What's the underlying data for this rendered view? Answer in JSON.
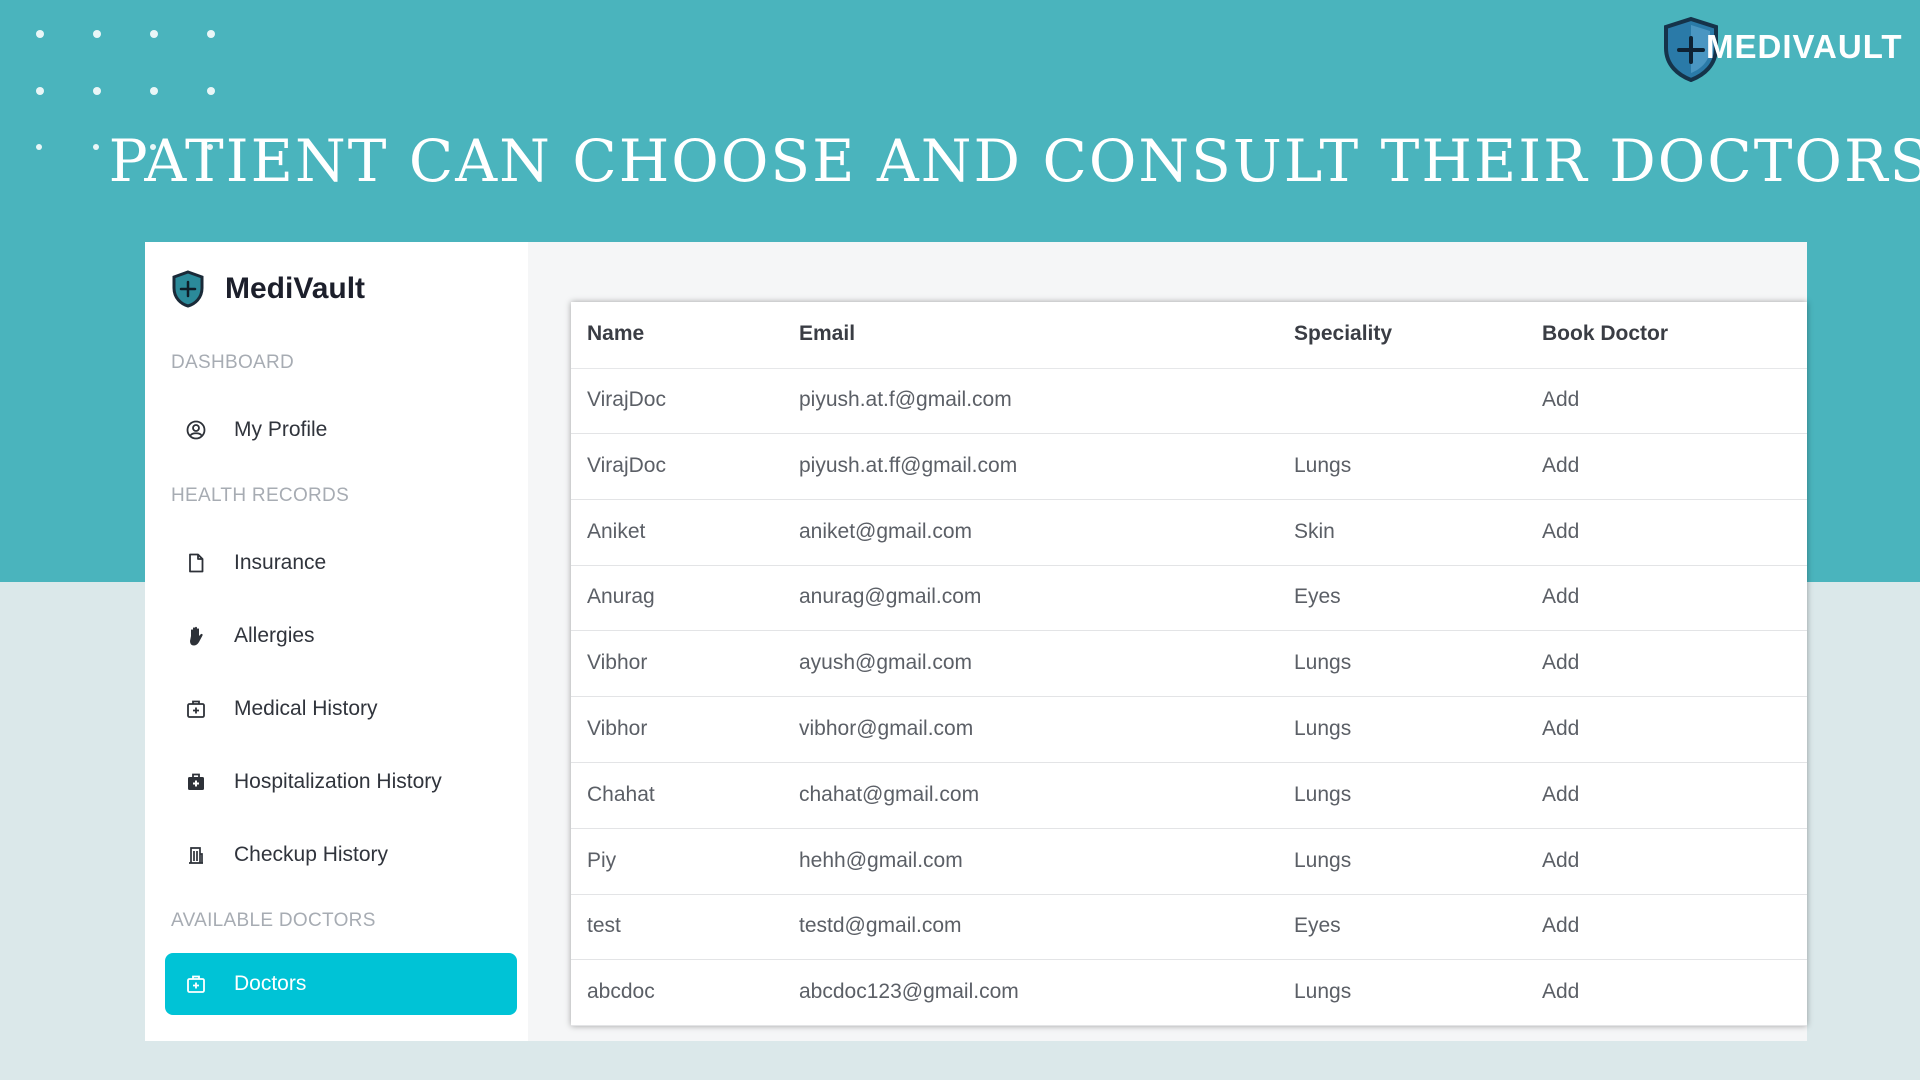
{
  "slide": {
    "title": "PATIENT CAN CHOOSE AND CONSULT THEIR DOCTORS",
    "brand": "MEDIVAULT",
    "colors": {
      "top_band": "#4ab4bd",
      "background": "#dbe8ea",
      "accent": "#00c3d6"
    }
  },
  "app": {
    "name": "MediVault",
    "sections": {
      "dashboard": "DASHBOARD",
      "health_records": "HEALTH RECORDS",
      "available_doctors": "AVAILABLE DOCTORS"
    },
    "nav": {
      "my_profile": {
        "label": "My Profile",
        "icon": "user-circle-icon"
      },
      "insurance": {
        "label": "Insurance",
        "icon": "file-icon"
      },
      "allergies": {
        "label": "Allergies",
        "icon": "hand-icon"
      },
      "medical_history": {
        "label": "Medical History",
        "icon": "medical-bag-icon"
      },
      "hospitalization_history": {
        "label": "Hospitalization History",
        "icon": "medical-kit-icon"
      },
      "checkup_history": {
        "label": "Checkup History",
        "icon": "hospital-icon"
      },
      "doctors": {
        "label": "Doctors",
        "icon": "medical-bag-icon",
        "active": true
      }
    }
  },
  "table": {
    "columns": {
      "name": "Name",
      "email": "Email",
      "speciality": "Speciality",
      "book": "Book Doctor"
    },
    "rows": [
      {
        "name": "VirajDoc",
        "email": "piyush.at.f@gmail.com",
        "speciality": "",
        "book": "Add"
      },
      {
        "name": "VirajDoc",
        "email": "piyush.at.ff@gmail.com",
        "speciality": "Lungs",
        "book": "Add"
      },
      {
        "name": "Aniket",
        "email": "aniket@gmail.com",
        "speciality": "Skin",
        "book": "Add"
      },
      {
        "name": "Anurag",
        "email": "anurag@gmail.com",
        "speciality": "Eyes",
        "book": "Add"
      },
      {
        "name": "Vibhor",
        "email": "ayush@gmail.com",
        "speciality": "Lungs",
        "book": "Add"
      },
      {
        "name": "Vibhor",
        "email": "vibhor@gmail.com",
        "speciality": "Lungs",
        "book": "Add"
      },
      {
        "name": "Chahat",
        "email": "chahat@gmail.com",
        "speciality": "Lungs",
        "book": "Add"
      },
      {
        "name": "Piy",
        "email": "hehh@gmail.com",
        "speciality": "Lungs",
        "book": "Add"
      },
      {
        "name": "test",
        "email": "testd@gmail.com",
        "speciality": "Eyes",
        "book": "Add"
      },
      {
        "name": "abcdoc",
        "email": "abcdoc123@gmail.com",
        "speciality": "Lungs",
        "book": "Add"
      }
    ]
  }
}
